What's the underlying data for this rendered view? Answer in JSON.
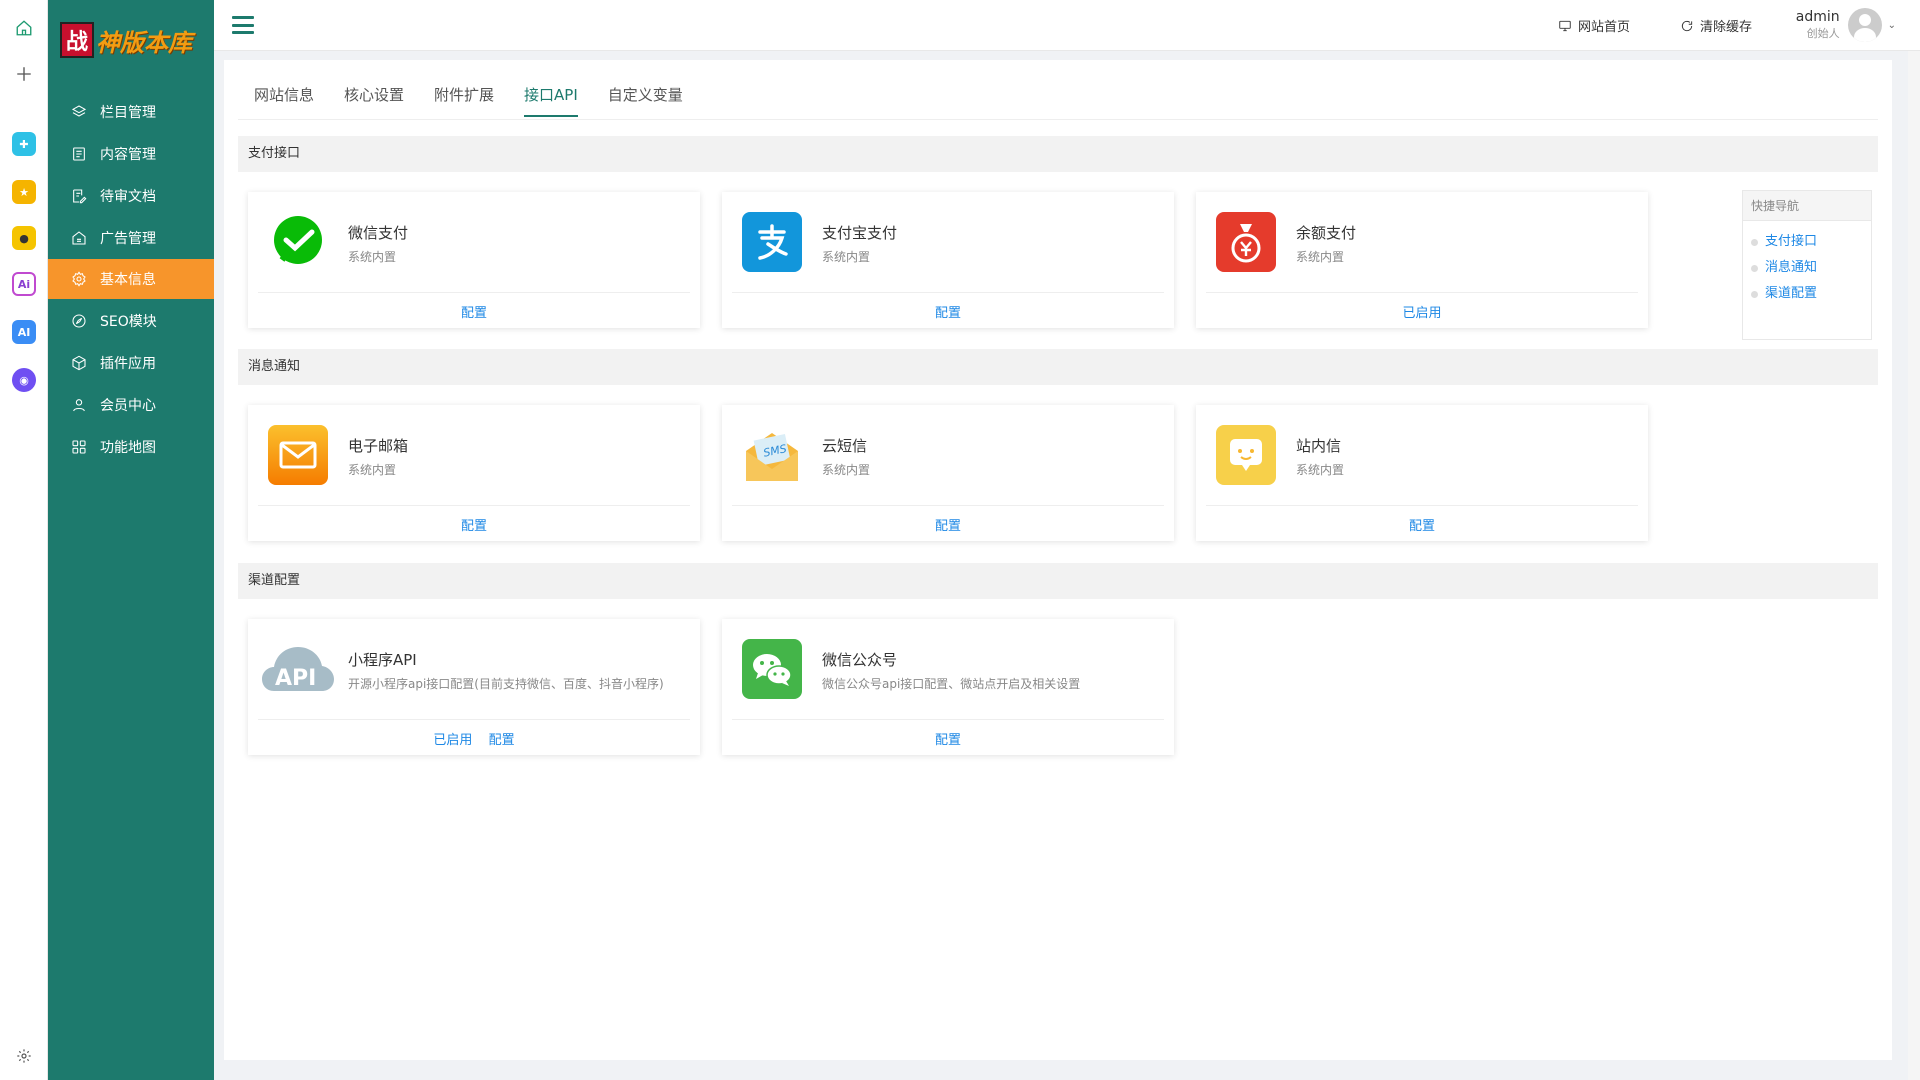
{
  "sidebar": {
    "logo": {
      "mark": "战",
      "text": "神版本库"
    },
    "items": [
      {
        "label": "栏目管理",
        "icon": "layers-icon"
      },
      {
        "label": "内容管理",
        "icon": "document-icon"
      },
      {
        "label": "待审文档",
        "icon": "edit-document-icon"
      },
      {
        "label": "广告管理",
        "icon": "ad-icon"
      },
      {
        "label": "基本信息",
        "icon": "gear-icon",
        "active": true
      },
      {
        "label": "SEO模块",
        "icon": "compass-icon"
      },
      {
        "label": "插件应用",
        "icon": "cube-icon"
      },
      {
        "label": "会员中心",
        "icon": "user-icon"
      },
      {
        "label": "功能地图",
        "icon": "grid-icon"
      }
    ]
  },
  "header": {
    "site_home": "网站首页",
    "clear_cache": "清除缓存",
    "user": {
      "name": "admin",
      "role": "创始人"
    }
  },
  "tabs": [
    {
      "label": "网站信息"
    },
    {
      "label": "核心设置"
    },
    {
      "label": "附件扩展"
    },
    {
      "label": "接口API",
      "active": true
    },
    {
      "label": "自定义变量"
    }
  ],
  "sections": {
    "payment": {
      "title": "支付接口",
      "cards": [
        {
          "title": "微信支付",
          "subtitle": "系统内置",
          "actions": [
            "配置"
          ],
          "icon": "wechat-pay-icon",
          "color": "#09bb07"
        },
        {
          "title": "支付宝支付",
          "subtitle": "系统内置",
          "actions": [
            "配置"
          ],
          "icon": "alipay-icon",
          "color": "#1296db"
        },
        {
          "title": "余额支付",
          "subtitle": "系统内置",
          "actions": [
            "已启用"
          ],
          "icon": "money-bag-icon",
          "color": "#e53b2c"
        }
      ]
    },
    "message": {
      "title": "消息通知",
      "cards": [
        {
          "title": "电子邮箱",
          "subtitle": "系统内置",
          "actions": [
            "配置"
          ],
          "icon": "mail-icon",
          "color": "#f7a21b"
        },
        {
          "title": "云短信",
          "subtitle": "系统内置",
          "actions": [
            "配置"
          ],
          "icon": "sms-icon",
          "color": "#f5b83d"
        },
        {
          "title": "站内信",
          "subtitle": "系统内置",
          "actions": [
            "配置"
          ],
          "icon": "chat-face-icon",
          "color": "#f7d04a"
        }
      ]
    },
    "channel": {
      "title": "渠道配置",
      "cards": [
        {
          "title": "小程序API",
          "subtitle": "开源小程序api接口配置(目前支持微信、百度、抖音小程序)",
          "actions": [
            "已启用",
            "配置"
          ],
          "icon": "api-cloud-icon",
          "color": "#a7bcc7"
        },
        {
          "title": "微信公众号",
          "subtitle": "微信公众号api接口配置、微站点开启及相关设置",
          "actions": [
            "配置"
          ],
          "icon": "wechat-icon",
          "color": "#44b549"
        }
      ]
    }
  },
  "quicknav": {
    "title": "快捷导航",
    "items": [
      "支付接口",
      "消息通知",
      "渠道配置"
    ]
  },
  "colors": {
    "sidebar": "#1d7a6d",
    "active": "#f7952b",
    "link": "#1e88e5"
  }
}
